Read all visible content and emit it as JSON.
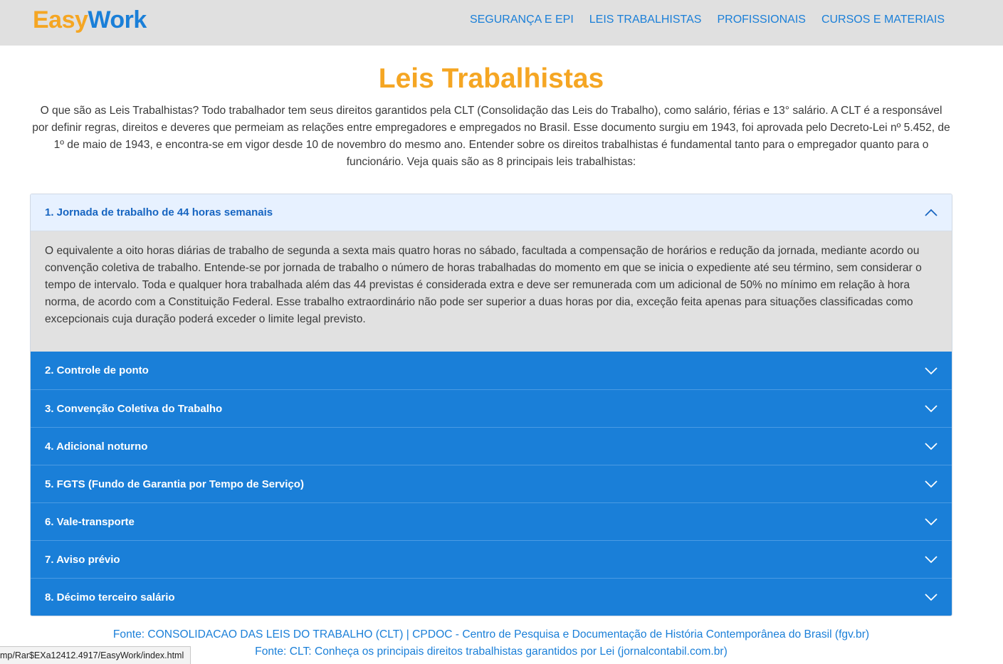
{
  "brand": {
    "part1": "Easy",
    "part2": "Work"
  },
  "nav": [
    {
      "label": "SEGURANÇA E EPI"
    },
    {
      "label": "LEIS TRABALHISTAS"
    },
    {
      "label": "PROFISSIONAIS"
    },
    {
      "label": "CURSOS E MATERIAIS"
    }
  ],
  "page": {
    "title": "Leis Trabalhistas",
    "intro": "O que são as Leis Trabalhistas? Todo trabalhador tem seus direitos garantidos pela CLT (Consolidação das Leis do Trabalho), como salário, férias e 13° salário. A CLT é a responsável por definir regras, direitos e deveres que permeiam as relações entre empregadores e empregados no Brasil. Esse documento surgiu em 1943, foi aprovada pelo Decreto-Lei nº 5.452, de 1º de maio de 1943, e encontra-se em vigor desde 10 de novembro do mesmo ano. Entender sobre os direitos trabalhistas é fundamental tanto para o empregador quanto para o funcionário. Veja quais são as 8 principais leis trabalhistas:"
  },
  "accordion": [
    {
      "label": "1. Jornada de trabalho de 44 horas semanais",
      "expanded": true,
      "body": "O equivalente a oito horas diárias de trabalho de segunda a sexta mais quatro horas no sábado, facultada a compensação de horários e redução da jornada, mediante acordo ou convenção coletiva de trabalho. Entende-se por jornada de trabalho o número de horas trabalhadas do momento em que se inicia o expediente até seu término, sem considerar o tempo de intervalo. Toda e qualquer hora trabalhada além das 44 previstas é considerada extra e deve ser remunerada com um adicional de 50% no mínimo em relação à hora norma, de acordo com a Constituição Federal. Esse trabalho extraordinário não pode ser superior a duas horas por dia, exceção feita apenas para situações classificadas como excepcionais cuja duração poderá exceder o limite legal previsto."
    },
    {
      "label": "2. Controle de ponto",
      "expanded": false
    },
    {
      "label": "3. Convenção Coletiva do Trabalho",
      "expanded": false
    },
    {
      "label": "4. Adicional noturno",
      "expanded": false
    },
    {
      "label": "5. FGTS (Fundo de Garantia por Tempo de Serviço)",
      "expanded": false
    },
    {
      "label": "6. Vale-transporte",
      "expanded": false
    },
    {
      "label": "7. Aviso prévio",
      "expanded": false
    },
    {
      "label": "8. Décimo terceiro salário",
      "expanded": false
    }
  ],
  "footer": {
    "links": [
      "Fonte: CONSOLIDACAO DAS LEIS DO TRABALHO (CLT) | CPDOC - Centro de Pesquisa e Documentação de História Contemporânea do Brasil (fgv.br)",
      "Fonte: CLT: Conheça os principais direitos trabalhistas garantidos por Lei (jornalcontabil.com.br)"
    ]
  },
  "status_bar": {
    "url": "mp/Rar$EXa12412.4917/EasyWork/index.html"
  },
  "colors": {
    "accent_orange": "#f5a623",
    "accent_blue": "#1a7fd8",
    "nav_bg": "#e0e0e0",
    "panel_bg": "#e1e1e1"
  },
  "icons": {
    "expanded": "chevron-up-icon",
    "collapsed": "chevron-down-icon"
  }
}
